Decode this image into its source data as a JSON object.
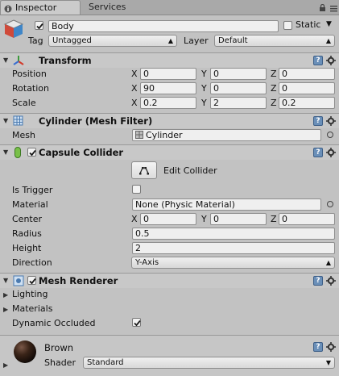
{
  "tabs": {
    "inspector": "Inspector",
    "services": "Services"
  },
  "object": {
    "name": "Body",
    "static_label": "Static",
    "tag_label": "Tag",
    "tag_value": "Untagged",
    "layer_label": "Layer",
    "layer_value": "Default",
    "active": true
  },
  "transform": {
    "title": "Transform",
    "position_label": "Position",
    "rotation_label": "Rotation",
    "scale_label": "Scale",
    "axis_x": "X",
    "axis_y": "Y",
    "axis_z": "Z",
    "position": {
      "x": "0",
      "y": "0",
      "z": "0"
    },
    "rotation": {
      "x": "90",
      "y": "0",
      "z": "0"
    },
    "scale": {
      "x": "0.2",
      "y": "2",
      "z": "0.2"
    }
  },
  "mesh_filter": {
    "title": "Cylinder (Mesh Filter)",
    "mesh_label": "Mesh",
    "mesh_value": "Cylinder"
  },
  "capsule_collider": {
    "title": "Capsule Collider",
    "edit_label": "Edit Collider",
    "is_trigger_label": "Is Trigger",
    "is_trigger": false,
    "material_label": "Material",
    "material_value": "None (Physic Material)",
    "center_label": "Center",
    "center": {
      "x": "0",
      "y": "0",
      "z": "0"
    },
    "radius_label": "Radius",
    "radius": "0.5",
    "height_label": "Height",
    "height": "2",
    "direction_label": "Direction",
    "direction": "Y-Axis"
  },
  "mesh_renderer": {
    "title": "Mesh Renderer",
    "lighting_label": "Lighting",
    "materials_label": "Materials",
    "dynamic_occluded_label": "Dynamic Occluded",
    "dynamic_occluded": true
  },
  "material": {
    "name": "Brown",
    "shader_label": "Shader",
    "shader_value": "Standard"
  },
  "icons": {
    "help": "?"
  }
}
